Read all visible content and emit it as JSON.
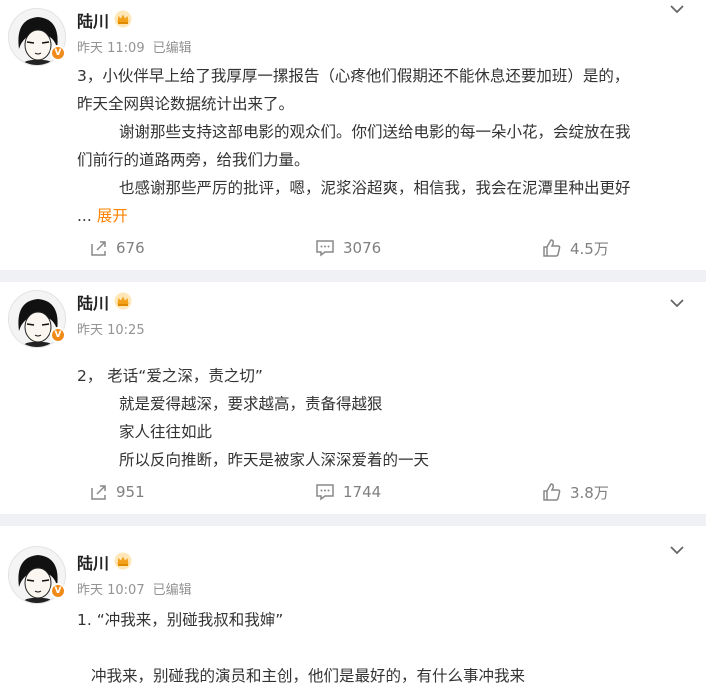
{
  "posts": [
    {
      "user": "陆川",
      "time": "昨天 11:09",
      "edited": "已编辑",
      "lines": [
        "3，小伙伴早上给了我厚厚一摞报告（心疼他们假期还不能休息还要加班）是的，",
        "昨天全网舆论数据统计出来了。",
        "谢谢那些支持这部电影的观众们。你们送给电影的每一朵小花，会绽放在我",
        "们前行的道路两旁，给我们力量。",
        "也感谢那些严厉的批评，嗯，泥浆浴超爽，相信我，我会在泥潭里种出更好"
      ],
      "ellipsis": "...",
      "expand": "展开",
      "reposts": "676",
      "comments": "3076",
      "likes": "4.5万"
    },
    {
      "user": "陆川",
      "time": "昨天 10:25",
      "lines": [
        "2， 老话“爱之深，责之切”",
        "就是爱得越深，要求越高，责备得越狠",
        "家人往往如此",
        "所以反向推断，昨天是被家人深深爱着的一天"
      ],
      "reposts": "951",
      "comments": "1744",
      "likes": "3.8万"
    },
    {
      "user": "陆川",
      "time": "昨天 10:07",
      "edited": "已编辑",
      "lines": [
        "1. “冲我来，别碰我叔和我婶”",
        "",
        "冲我来，别碰我的演员和主创，他们是最好的，有什么事冲我来"
      ]
    }
  ],
  "colors": {
    "accent": "#ff8200",
    "meta": "#939393",
    "badge": "#f08b1b",
    "separator": "#f0f1f4"
  },
  "icons": [
    "avatar",
    "verified-badge-icon",
    "crown-icon",
    "chevron-down-icon",
    "repost-icon",
    "comment-icon",
    "like-icon"
  ]
}
